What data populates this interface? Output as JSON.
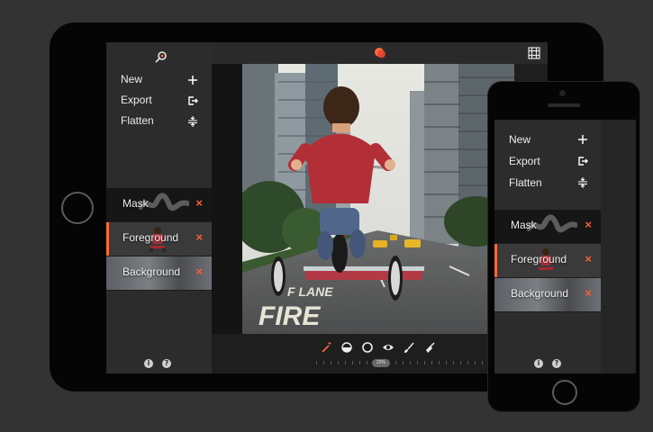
{
  "menu": {
    "items": [
      {
        "label": "New",
        "icon": "plus-icon"
      },
      {
        "label": "Export",
        "icon": "export-icon"
      },
      {
        "label": "Flatten",
        "icon": "flatten-icon"
      }
    ]
  },
  "layers": [
    {
      "label": "Mask",
      "delete_symbol": "×"
    },
    {
      "label": "Foreground",
      "delete_symbol": "×",
      "selected": true
    },
    {
      "label": "Background",
      "delete_symbol": "×"
    }
  ],
  "bottom_icons": [
    "info-icon",
    "help-icon"
  ],
  "toolbar": {
    "tools": [
      "magic-wand-icon",
      "half-circle-icon",
      "circle-icon",
      "eye-icon",
      "brush-icon",
      "broom-icon"
    ],
    "zoom_label": "22%",
    "zoom_percent": 22
  },
  "photo_text": {
    "lane": "F LANE",
    "fire": "FIRE"
  },
  "colors": {
    "accent": "#ff6a3c",
    "delete": "#ff5d38",
    "panel": "#2c2c2c",
    "device": "#050505",
    "background": "#333333"
  }
}
